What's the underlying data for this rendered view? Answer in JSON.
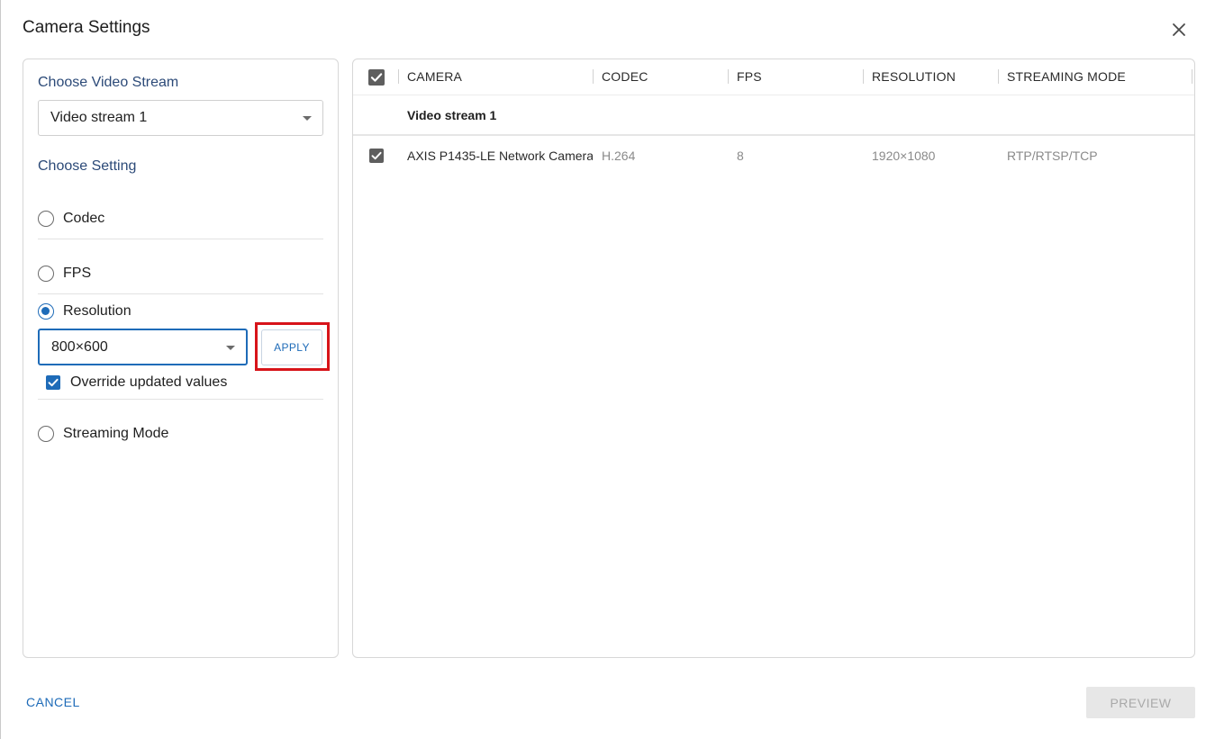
{
  "dialog": {
    "title": "Camera Settings",
    "close_icon": "close-icon"
  },
  "left": {
    "stream_label": "Choose Video Stream",
    "stream_value": "Video stream 1",
    "setting_label": "Choose Setting",
    "options": [
      {
        "label": "Codec",
        "selected": false
      },
      {
        "label": "FPS",
        "selected": false
      },
      {
        "label": "Resolution",
        "selected": true
      },
      {
        "label": "Streaming Mode",
        "selected": false
      }
    ],
    "resolution_value": "800×600",
    "apply_label": "APPLY",
    "override_label": "Override updated values",
    "override_checked": true
  },
  "table": {
    "columns": [
      "CAMERA",
      "CODEC",
      "FPS",
      "RESOLUTION",
      "STREAMING MODE"
    ],
    "group_label": "Video stream 1",
    "rows": [
      {
        "camera": "AXIS P1435-LE Network Camera",
        "codec": "H.264",
        "fps": "8",
        "resolution": "1920×1080",
        "streaming_mode": "RTP/RTSP/TCP",
        "checked": true
      }
    ]
  },
  "footer": {
    "cancel_label": "CANCEL",
    "preview_label": "PREVIEW"
  },
  "colors": {
    "accent": "#1e6bb8",
    "highlight": "#d7141a",
    "label_blue": "#2c4a78"
  }
}
